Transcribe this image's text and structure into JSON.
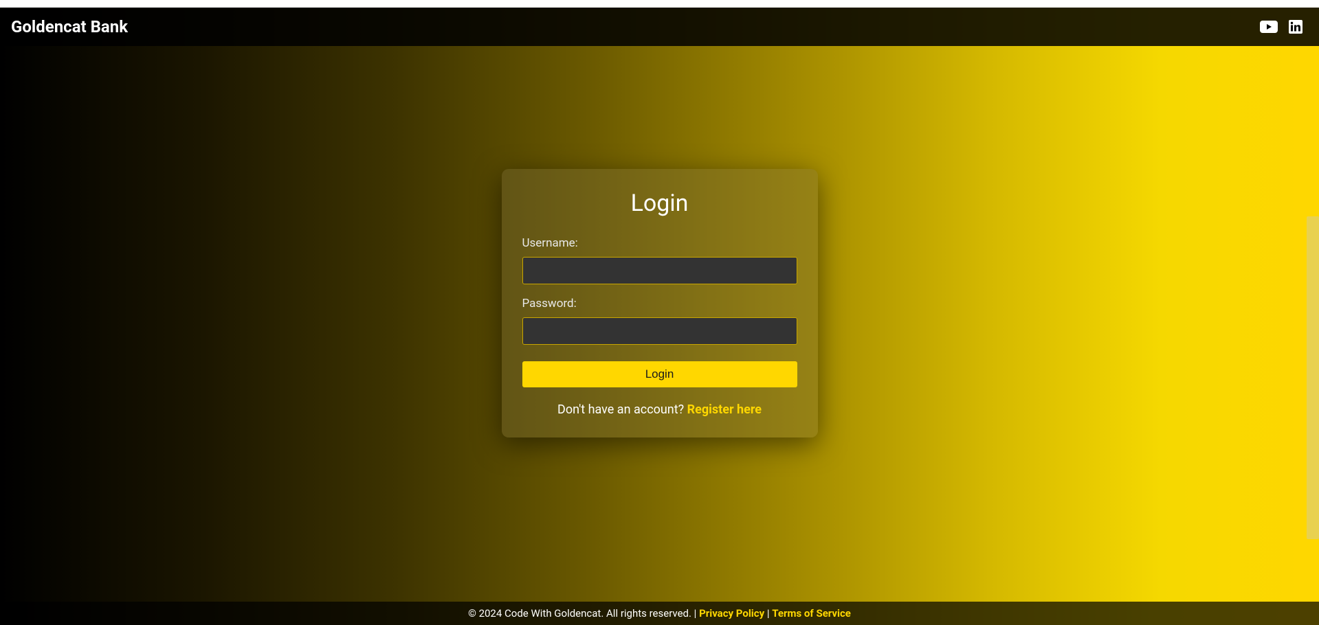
{
  "header": {
    "brand": "Goldencat Bank"
  },
  "login": {
    "title": "Login",
    "username_label": "Username:",
    "username_value": "",
    "password_label": "Password:",
    "password_value": "",
    "button_label": "Login",
    "prompt_text": "Don't have an account? ",
    "register_link": "Register here"
  },
  "footer": {
    "copyright": "© 2024 Code With Goldencat. All rights reserved. | ",
    "privacy_link": "Privacy Policy",
    "separator": " | ",
    "terms_link": "Terms of Service"
  }
}
